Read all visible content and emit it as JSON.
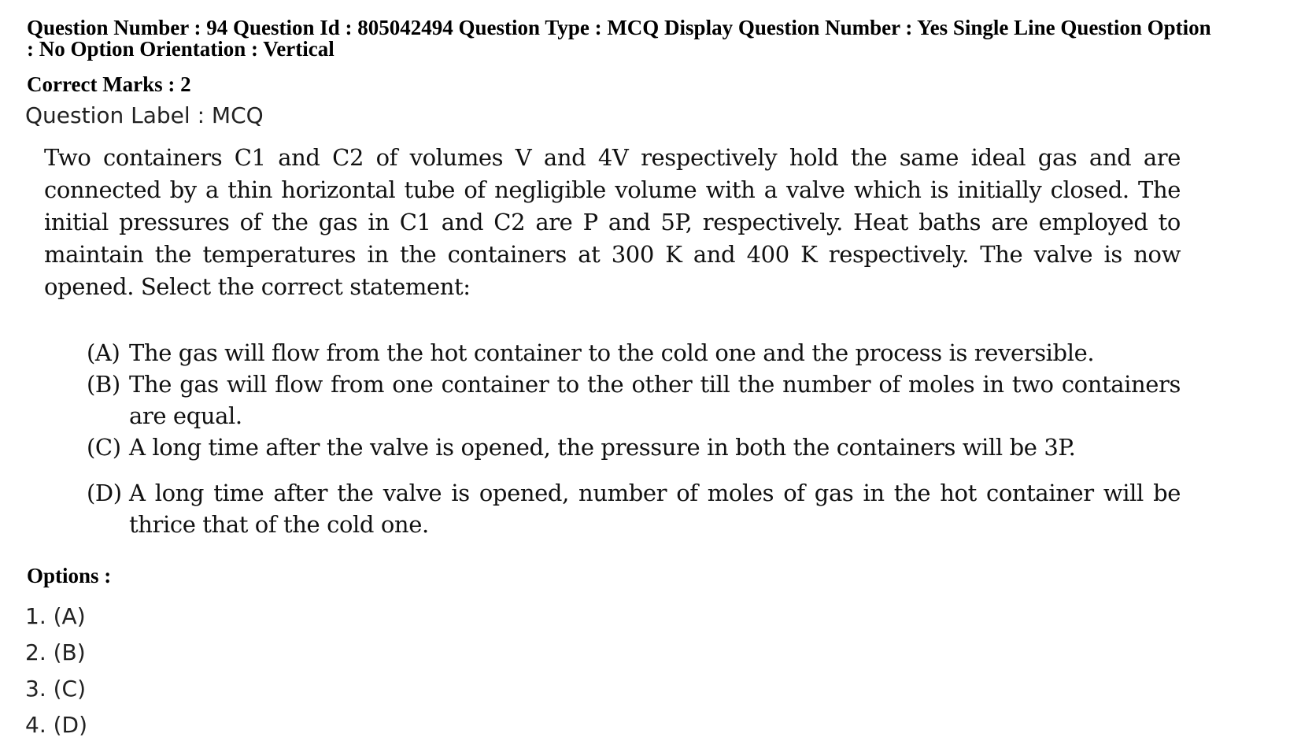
{
  "meta": {
    "line1": "Question Number : 94  Question Id : 805042494  Question Type : MCQ  Display Question Number : Yes  Single Line Question Option",
    "line2": ": No  Option Orientation : Vertical"
  },
  "correct_marks": "Correct Marks : 2",
  "question_label": "Question Label : MCQ",
  "question": {
    "text": "Two containers C1 and C2 of volumes V and 4V respectively hold the same ideal gas and are connected by a thin horizontal tube of negligible volume with a valve which is initially closed. The initial pressures of the gas in C1 and C2 are P and 5P, respectively. Heat baths are employed to maintain the temperatures in the containers at 300 K and 400 K respectively. The valve is now opened. Select the correct statement:",
    "choices": [
      {
        "tag": "(A)",
        "text": "The gas will flow from the hot container to the cold one and the process is reversible."
      },
      {
        "tag": "(B)",
        "text": "The gas will flow from one container to the other till the number of moles in two containers are equal."
      },
      {
        "tag": "(C)",
        "text": "A long time after the valve is opened, the pressure in both the containers will be 3P."
      },
      {
        "tag": "(D)",
        "text": "A long time after the valve is opened, number of moles of gas in the hot container will be thrice that of the cold one."
      }
    ]
  },
  "options_title": "Options :",
  "options": [
    {
      "label": "1. (A)"
    },
    {
      "label": "2. (B)"
    },
    {
      "label": "3. (C)"
    },
    {
      "label": "4. (D)"
    }
  ]
}
